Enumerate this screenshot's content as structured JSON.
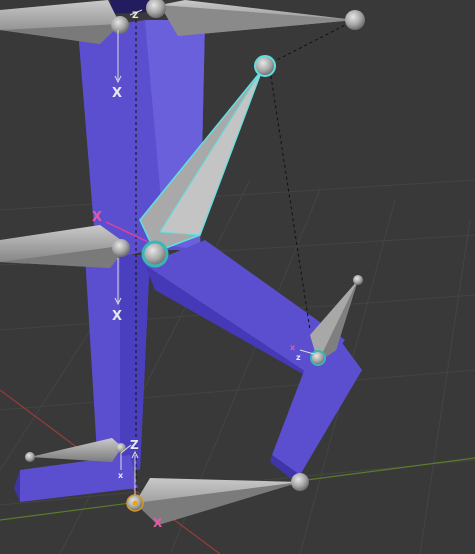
{
  "viewport": {
    "colors": {
      "background": "#393939",
      "grid": "#444444",
      "x_axis": "#9a3b3b",
      "y_axis": "#5c7a2a",
      "leg_mesh": "#5b4fd0",
      "leg_mesh_dark": "#3f35a8",
      "bone": "#9b9b9b",
      "bone_selected": "#bfbfbf",
      "selection_outline": "#5fe0e0",
      "ik_line": "#111111"
    },
    "axis_labels": {
      "hip_x_top": "X",
      "hip_x_mid": "X",
      "knee_x": "X",
      "hip_z_top": "Z",
      "foot_z": "Z",
      "foot_x": "X",
      "knee_z_small": "z",
      "knee_x_small": "x",
      "foot_x_small": "x"
    }
  }
}
